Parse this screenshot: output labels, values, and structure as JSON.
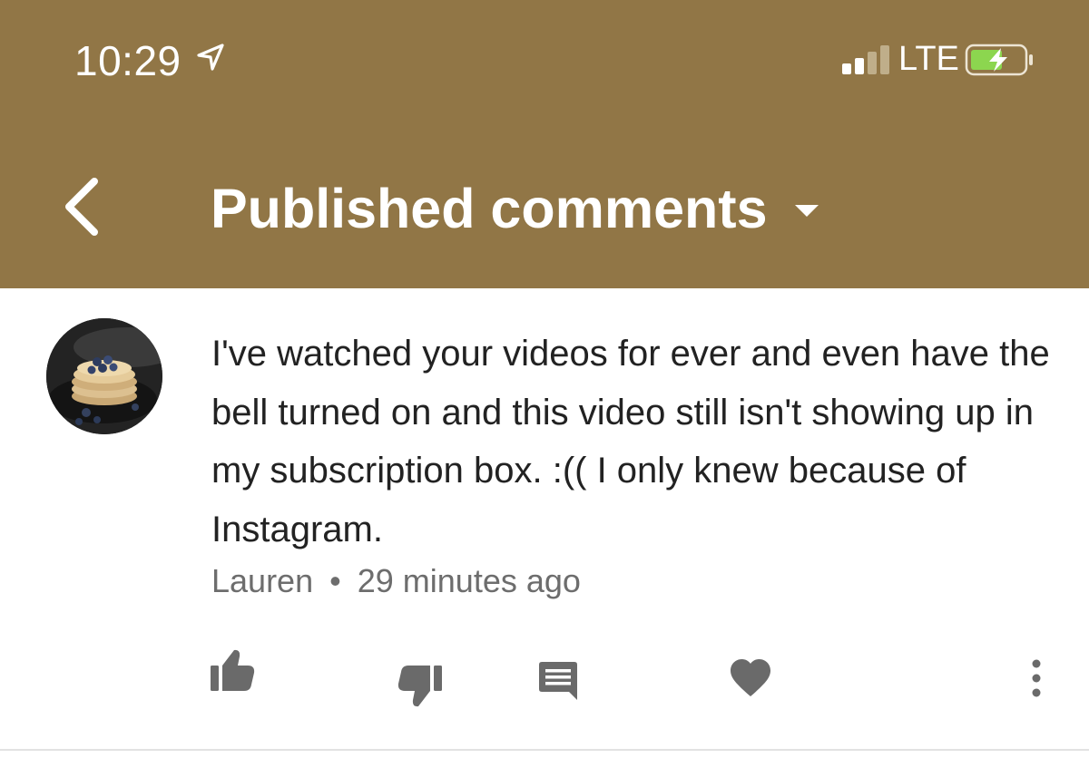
{
  "status_bar": {
    "time": "10:29",
    "network": "LTE",
    "icons": [
      "location-arrow-icon",
      "signal-icon",
      "battery-charging-icon"
    ]
  },
  "header": {
    "back_icon": "chevron-left-icon",
    "title": "Published comments",
    "dropdown_icon": "caret-down-icon"
  },
  "comment": {
    "avatar": "pancakes-with-blueberries",
    "text": "I've watched your videos for ever and even have the bell turned on and this video still isn't showing up in my subscription box. :(( I only knew because of Instagram.",
    "author": "Lauren",
    "separator": "•",
    "time_ago": "29 minutes ago"
  },
  "actions": [
    "thumbs-up-icon",
    "thumbs-down-icon",
    "reply-icon",
    "heart-icon",
    "more-icon"
  ],
  "colors": {
    "header_bg": "#917646",
    "header_text": "#ffffff",
    "body_text": "#222222",
    "meta_text": "#6d6d6d",
    "icon_gray": "#6a6a6a",
    "battery_green": "#8cd64f"
  }
}
